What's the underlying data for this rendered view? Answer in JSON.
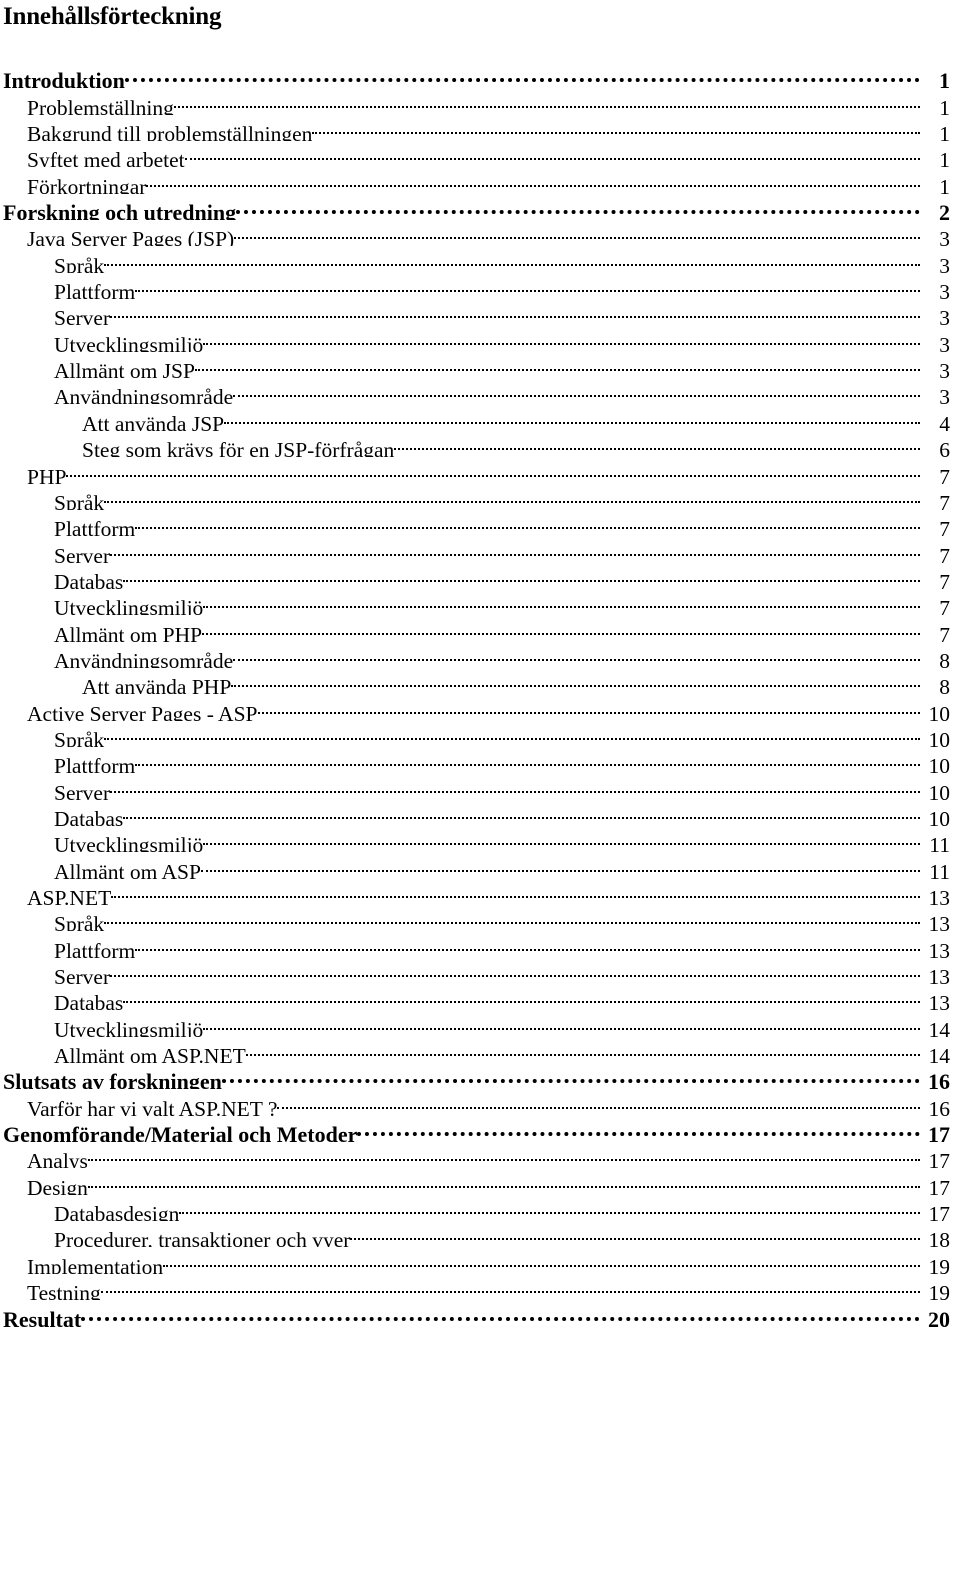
{
  "document": {
    "title": "Innehållsförteckning",
    "language": "sv"
  },
  "toc": {
    "entries": [
      {
        "label": "Introduktion",
        "page": "1",
        "level": 1,
        "bold": true
      },
      {
        "label": "Problemställning",
        "page": "1",
        "level": 2,
        "bold": false
      },
      {
        "label": "Bakgrund till problemställningen",
        "page": "1",
        "level": 2,
        "bold": false
      },
      {
        "label": "Syftet med arbetet",
        "page": "1",
        "level": 2,
        "bold": false
      },
      {
        "label": "Förkortningar",
        "page": "1",
        "level": 2,
        "bold": false
      },
      {
        "label": "Forskning och utredning",
        "page": "2",
        "level": 1,
        "bold": true
      },
      {
        "label": "Java Server Pages (JSP)",
        "page": "3",
        "level": 2,
        "bold": false
      },
      {
        "label": "Språk",
        "page": "3",
        "level": 3,
        "bold": false
      },
      {
        "label": "Plattform",
        "page": "3",
        "level": 3,
        "bold": false
      },
      {
        "label": "Server",
        "page": "3",
        "level": 3,
        "bold": false
      },
      {
        "label": "Utvecklingsmiljö",
        "page": "3",
        "level": 3,
        "bold": false
      },
      {
        "label": "Allmänt om JSP",
        "page": "3",
        "level": 3,
        "bold": false
      },
      {
        "label": "Användningsområde",
        "page": "3",
        "level": 3,
        "bold": false
      },
      {
        "label": "Att använda JSP",
        "page": "4",
        "level": 4,
        "bold": false
      },
      {
        "label": "Steg som krävs för en JSP-förfrågan",
        "page": "6",
        "level": 4,
        "bold": false
      },
      {
        "label": "PHP",
        "page": "7",
        "level": 2,
        "bold": false
      },
      {
        "label": "Språk",
        "page": "7",
        "level": 3,
        "bold": false
      },
      {
        "label": "Plattform",
        "page": "7",
        "level": 3,
        "bold": false
      },
      {
        "label": "Server",
        "page": "7",
        "level": 3,
        "bold": false
      },
      {
        "label": "Databas",
        "page": "7",
        "level": 3,
        "bold": false
      },
      {
        "label": "Utvecklingsmiljö",
        "page": "7",
        "level": 3,
        "bold": false
      },
      {
        "label": "Allmänt om PHP",
        "page": "7",
        "level": 3,
        "bold": false
      },
      {
        "label": "Användningsområde",
        "page": "8",
        "level": 3,
        "bold": false
      },
      {
        "label": "Att använda PHP",
        "page": "8",
        "level": 4,
        "bold": false
      },
      {
        "label": "Active Server Pages - ASP",
        "page": "10",
        "level": 2,
        "bold": false
      },
      {
        "label": "Språk",
        "page": "10",
        "level": 3,
        "bold": false
      },
      {
        "label": "Plattform",
        "page": "10",
        "level": 3,
        "bold": false
      },
      {
        "label": "Server",
        "page": "10",
        "level": 3,
        "bold": false
      },
      {
        "label": "Databas",
        "page": "10",
        "level": 3,
        "bold": false
      },
      {
        "label": "Utvecklingsmiljö",
        "page": "11",
        "level": 3,
        "bold": false
      },
      {
        "label": "Allmänt om ASP",
        "page": "11",
        "level": 3,
        "bold": false
      },
      {
        "label": "ASP.NET",
        "page": "13",
        "level": 2,
        "bold": false
      },
      {
        "label": "Språk",
        "page": "13",
        "level": 3,
        "bold": false
      },
      {
        "label": "Plattform",
        "page": "13",
        "level": 3,
        "bold": false
      },
      {
        "label": "Server",
        "page": "13",
        "level": 3,
        "bold": false
      },
      {
        "label": "Databas",
        "page": "13",
        "level": 3,
        "bold": false
      },
      {
        "label": "Utvecklingsmiljö",
        "page": "14",
        "level": 3,
        "bold": false
      },
      {
        "label": "Allmänt om ASP.NET",
        "page": "14",
        "level": 3,
        "bold": false
      },
      {
        "label": "Slutsats av forskningen",
        "page": "16",
        "level": 1,
        "bold": true
      },
      {
        "label": "Varför har vi valt ASP.NET ?",
        "page": "16",
        "level": 2,
        "bold": false
      },
      {
        "label": "Genomförande/Material och Metoder",
        "page": "17",
        "level": 1,
        "bold": true
      },
      {
        "label": "Analys",
        "page": "17",
        "level": 2,
        "bold": false
      },
      {
        "label": "Design",
        "page": "17",
        "level": 2,
        "bold": false
      },
      {
        "label": "Databasdesign",
        "page": "17",
        "level": 3,
        "bold": false
      },
      {
        "label": "Procedurer, transaktioner och vyer",
        "page": "18",
        "level": 3,
        "bold": false
      },
      {
        "label": "Implementation",
        "page": "19",
        "level": 2,
        "bold": false
      },
      {
        "label": "Testning",
        "page": "19",
        "level": 2,
        "bold": false
      },
      {
        "label": "Resultat",
        "page": "20",
        "level": 1,
        "bold": true
      }
    ]
  }
}
